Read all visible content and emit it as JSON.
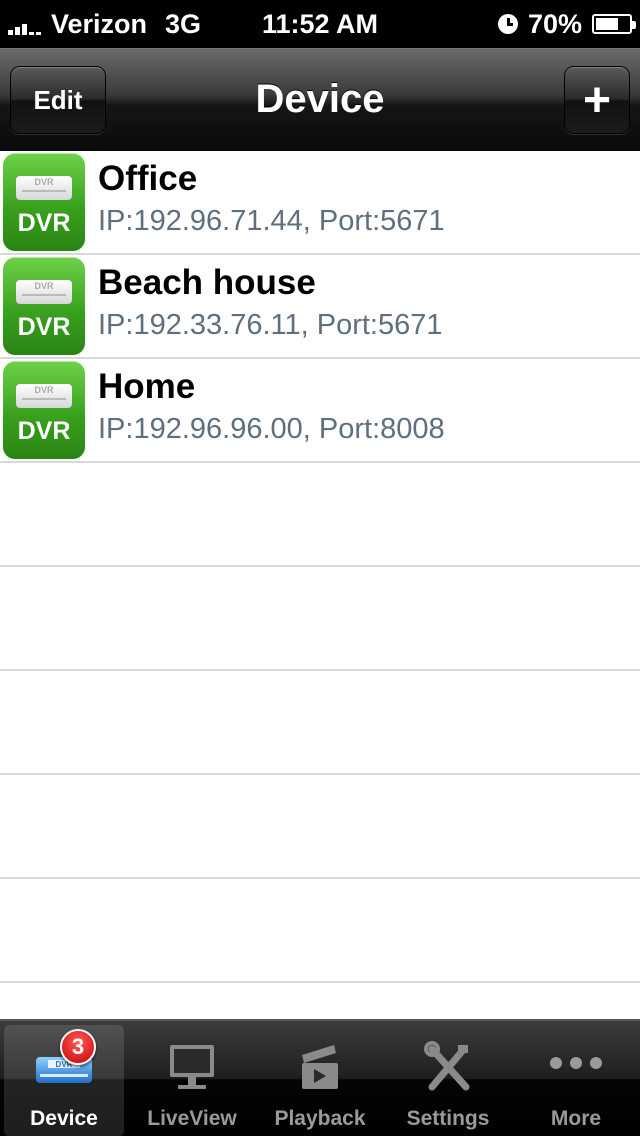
{
  "status_bar": {
    "carrier": "Verizon",
    "network": "3G",
    "time": "11:52 AM",
    "battery": "70%",
    "battery_level": 0.7
  },
  "nav": {
    "edit_label": "Edit",
    "title": "Device",
    "add_label": "+"
  },
  "devices": [
    {
      "icon_label": "DVR",
      "name": "Office",
      "detail": "IP:192.96.71.44, Port:5671"
    },
    {
      "icon_label": "DVR",
      "name": "Beach house",
      "detail": "IP:192.33.76.11, Port:5671"
    },
    {
      "icon_label": "DVR",
      "name": "Home",
      "detail": "IP:192.96.96.00, Port:8008"
    }
  ],
  "tabs": [
    {
      "label": "Device",
      "icon": "dvr-icon",
      "badge": "3",
      "active": true
    },
    {
      "label": "LiveView",
      "icon": "monitor-icon"
    },
    {
      "label": "Playback",
      "icon": "clapperboard-icon"
    },
    {
      "label": "Settings",
      "icon": "tools-icon"
    },
    {
      "label": "More",
      "icon": "more-dots-icon"
    }
  ],
  "colors": {
    "dvr_green": "#3aa11f",
    "detail_text": "#5f6f80",
    "badge_red": "#c80000",
    "active_tab_icon": "#3d8ee0"
  }
}
